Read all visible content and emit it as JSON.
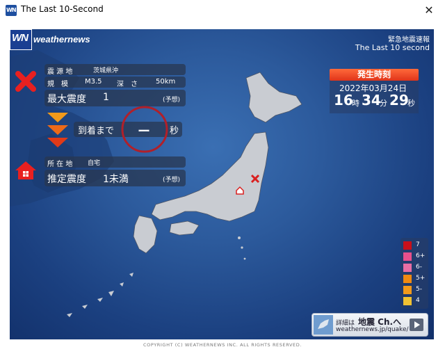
{
  "window": {
    "title": "The Last 10-Second",
    "close": "✕",
    "app_icon_text": "WN"
  },
  "brand": {
    "logo_mark": "WN",
    "logo_name": "weathernews"
  },
  "header": {
    "line1": "緊急地震速報",
    "line2": "The Last 10 second"
  },
  "quake": {
    "epicenter_label": "震 源 地",
    "epicenter": "茨城県沖",
    "scale_label": "規　模",
    "magnitude": "M3.5",
    "depth_label": "深　さ",
    "depth": "50km",
    "max_intensity_label": "最大震度",
    "max_intensity": "1",
    "max_intensity_note": "(予想)",
    "arrival_label": "到着まで",
    "arrival_value": "ー",
    "arrival_unit": "秒"
  },
  "location": {
    "label": "所 在 地",
    "place": "自宅",
    "est_intensity_label": "推定震度",
    "est_intensity": "1未満",
    "est_note": "(予想)"
  },
  "occurrence": {
    "title": "発生時刻",
    "date": "2022年03月24日",
    "hour": "16",
    "hour_unit": "時",
    "minute": "34",
    "minute_unit": "分",
    "second": "29",
    "second_unit": "秒"
  },
  "legend": [
    {
      "label": "7",
      "color": "#c8101a"
    },
    {
      "label": "6+",
      "color": "#e8508c"
    },
    {
      "label": "6-",
      "color": "#e86ea4"
    },
    {
      "label": "5+",
      "color": "#f08a10"
    },
    {
      "label": "5-",
      "color": "#f39a1a"
    },
    {
      "label": "4",
      "color": "#f2c232"
    }
  ],
  "info": {
    "prefix": "詳細は",
    "channel": "地震 Ch.へ",
    "url": "weathernews.jp/quake/"
  },
  "footer": "COPYRIGHT (C) WEATHERNEWS INC. ALL RIGHTS RESERVED.",
  "colors": {
    "epicenter_x": "#d92020",
    "alert_head": "#e8401e",
    "home_icon": "#d92020",
    "arrival_circle": "#b0202a"
  }
}
